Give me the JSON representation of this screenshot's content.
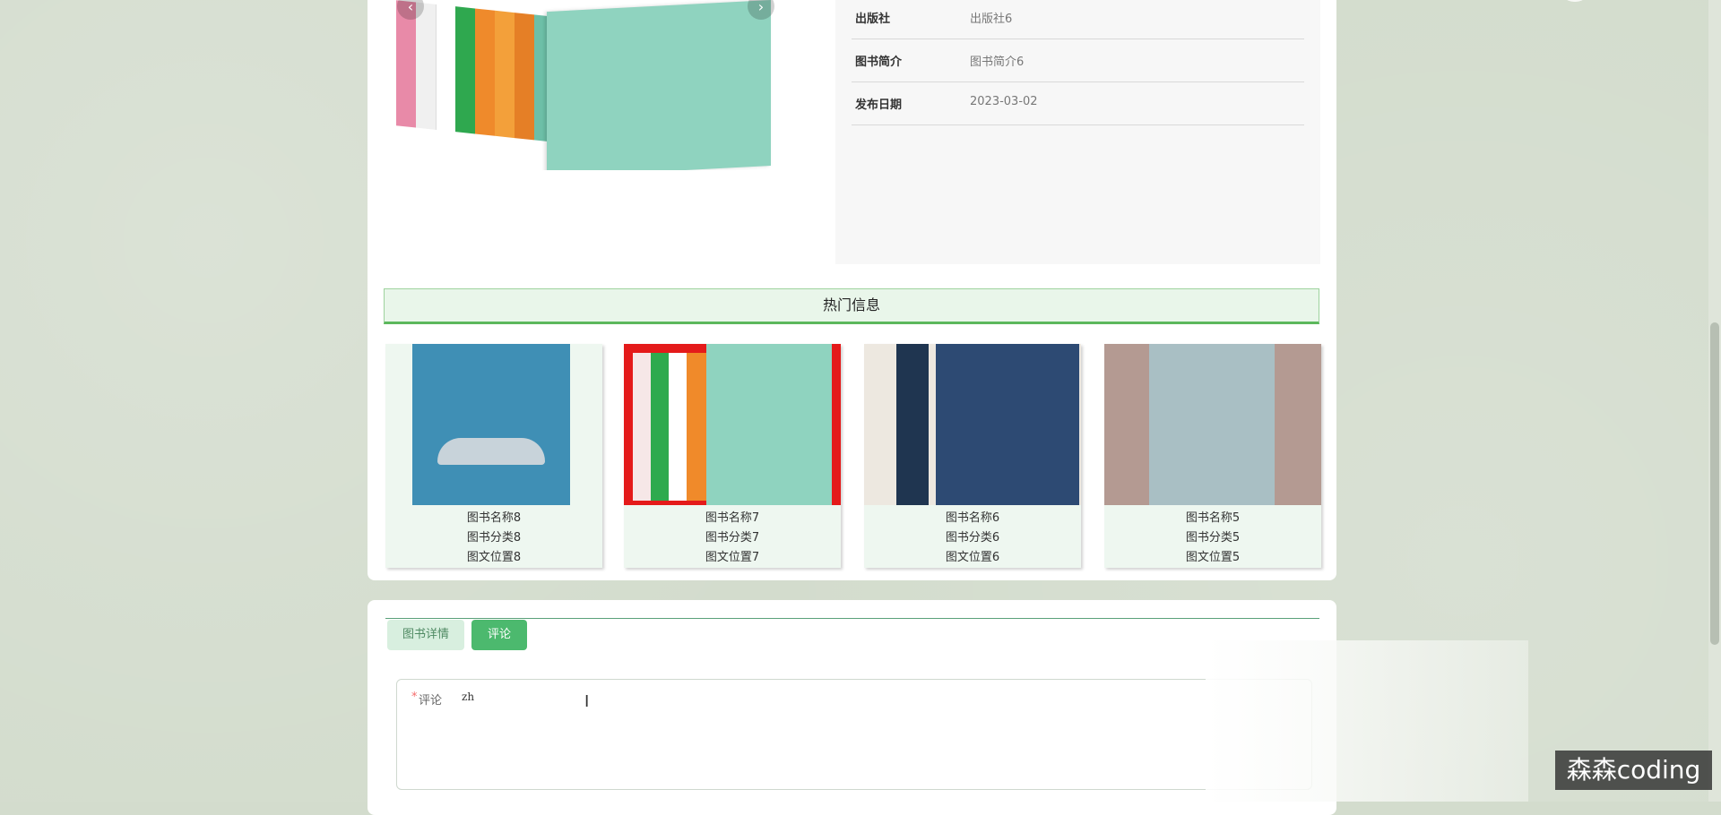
{
  "book_detail": {
    "rows": [
      {
        "key": "出版社",
        "value": "出版社6"
      },
      {
        "key": "图书简介",
        "value": "图书简介6"
      },
      {
        "key": "发布日期",
        "value": "2023-03-02"
      }
    ]
  },
  "carousel": {
    "prev_icon": "‹",
    "next_icon": "›"
  },
  "hot": {
    "title": "热门信息",
    "items": [
      {
        "name": "图书名称8",
        "category": "图书分类8",
        "position": "图文位置8"
      },
      {
        "name": "图书名称7",
        "category": "图书分类7",
        "position": "图文位置7"
      },
      {
        "name": "图书名称6",
        "category": "图书分类6",
        "position": "图文位置6"
      },
      {
        "name": "图书名称5",
        "category": "图书分类5",
        "position": "图文位置5"
      }
    ]
  },
  "tabs": {
    "detail": "图书详情",
    "comment": "评论"
  },
  "comment_form": {
    "required_mark": "*",
    "label": "评论",
    "value": "zh"
  },
  "watermark": "森森coding",
  "colors": {
    "accent": "#4cb96e",
    "header_bg": "#e9f6ea",
    "page_bg": "#d3dccd"
  }
}
